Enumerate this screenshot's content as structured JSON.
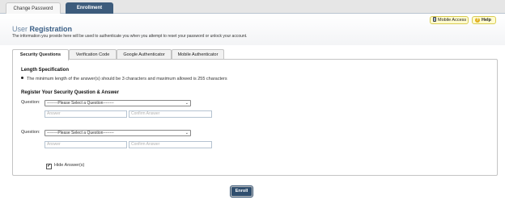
{
  "top_tabs": [
    {
      "label": "Change Password",
      "active": false
    },
    {
      "label": "Enrollment",
      "active": true
    }
  ],
  "header": {
    "title_main": "User",
    "title_sub": "Registration",
    "description": "The information you provide here will be used to authenticate you when you attempt to reset your password or unlock your account."
  },
  "header_buttons": {
    "mobile_access": "Mobile Access",
    "help": "Help"
  },
  "tabs": [
    {
      "label": "Security Questions",
      "active": true
    },
    {
      "label": "Verification Code",
      "active": false
    },
    {
      "label": "Google Authenticator",
      "active": false
    },
    {
      "label": "Mobile Authenticator",
      "active": false
    }
  ],
  "length_spec": {
    "heading": "Length Specification",
    "rule": "The minimum length of the answer(s) should be 3 characters and maximum allowed is 255 characters"
  },
  "register": {
    "heading": "Register Your Security Question & Answer",
    "questions": [
      {
        "label": "Question:",
        "selected": "--------Please Select a Question--------",
        "answer_placeholder": "Answer",
        "confirm_placeholder": "Confirm Answer"
      },
      {
        "label": "Question:",
        "selected": "--------Please Select a Question--------",
        "answer_placeholder": "Answer",
        "confirm_placeholder": "Confirm Answer"
      }
    ]
  },
  "hide_answers": {
    "label": "Hide Answer(s)",
    "checked": true
  },
  "enroll_button": "Enroll",
  "colors": {
    "accent": "#3a5f86",
    "active_tab": "#3d5c7c",
    "enroll": "#2f4e6e",
    "help_bg": "#fffbd0"
  }
}
